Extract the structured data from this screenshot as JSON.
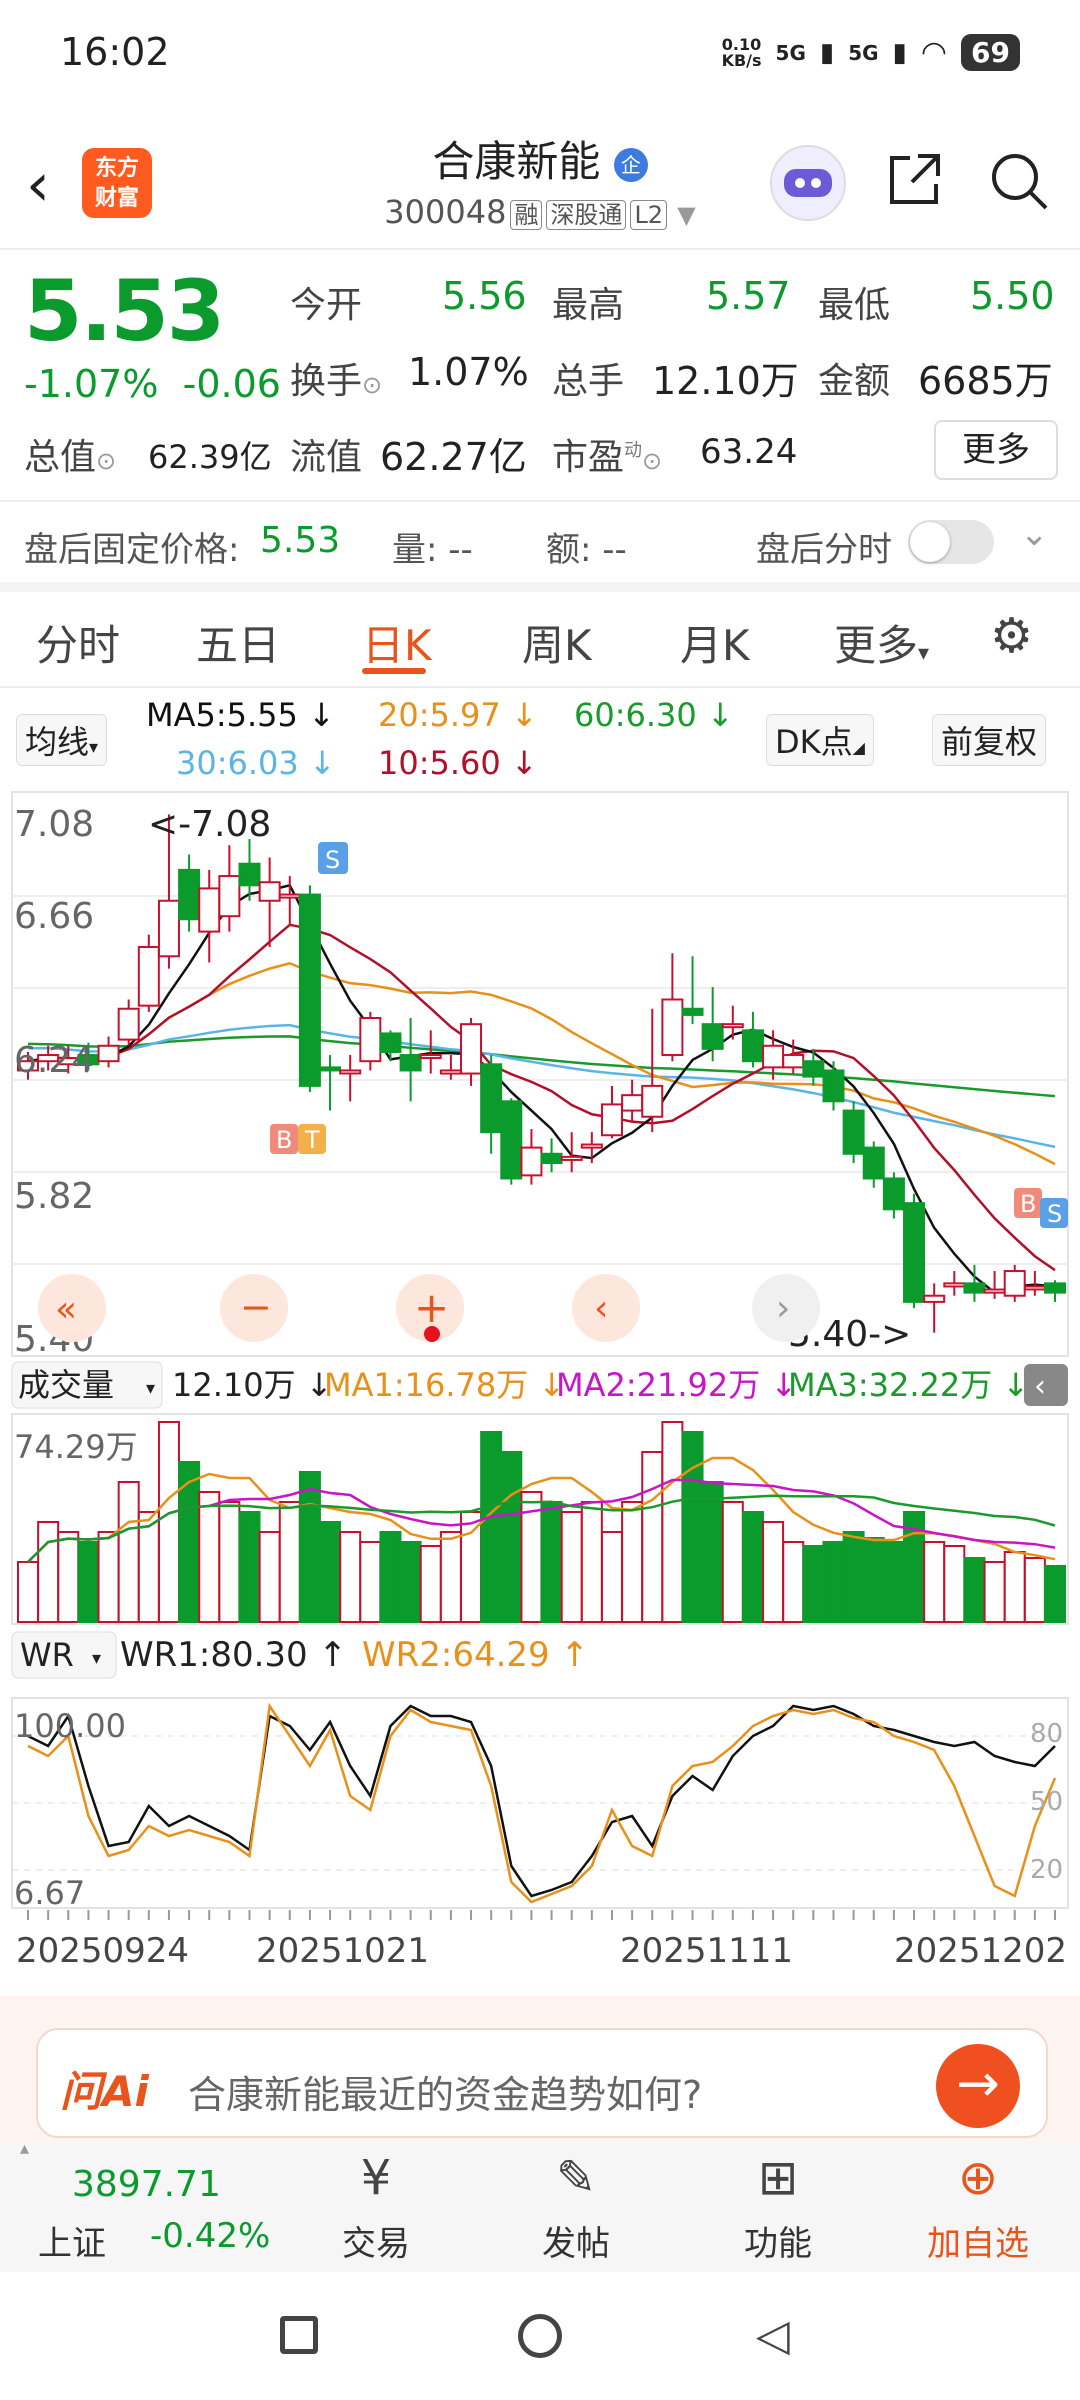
{
  "status": {
    "time": "16:02",
    "net_speed": "0.10\nKB/s",
    "signal1": "5G",
    "signal2": "5G",
    "battery": "69"
  },
  "header": {
    "logo_line1": "东方",
    "logo_line2": "财富",
    "stock_name": "合康新能",
    "badge": "企",
    "code": "300048",
    "tags": [
      "融",
      "深股通",
      "L2"
    ]
  },
  "quote": {
    "price": "5.53",
    "change_pct": "-1.07%",
    "change": "-0.06",
    "open_label": "今开",
    "open": "5.56",
    "high_label": "最高",
    "high": "5.57",
    "low_label": "最低",
    "low": "5.50",
    "turnover_label": "换手",
    "turnover": "1.07%",
    "volume_label": "总手",
    "volume": "12.10万",
    "amount_label": "金额",
    "amount": "6685万",
    "mcap_label": "总值",
    "mcap": "62.39亿",
    "float_label": "流值",
    "float": "62.27亿",
    "pe_label": "市盈",
    "pe_sup": "动",
    "pe": "63.24",
    "more": "更多"
  },
  "after_hours": {
    "label": "盘后固定价格:",
    "price": "5.53",
    "vol_label": "量: --",
    "amt_label": "额: --",
    "toggle_label": "盘后分时"
  },
  "tabs": [
    "分时",
    "五日",
    "日K",
    "周K",
    "月K",
    "更多"
  ],
  "ma_bar": {
    "selector": "均线",
    "ma5": "MA5:5.55 ↓",
    "ma20": "20:5.97 ↓",
    "ma60": "60:6.30 ↓",
    "ma30": "30:6.03 ↓",
    "ma10": "10:5.60 ↓",
    "dk": "DK点",
    "fq": "前复权"
  },
  "kline": {
    "y_labels": [
      "7.08",
      "6.66",
      "6.24",
      "5.82",
      "5.40"
    ],
    "high_marker": "<-7.08",
    "low_marker": "5.40->",
    "signal_buy": "B",
    "signal_t": "T",
    "signal_sell": "S"
  },
  "volume_bar": {
    "selector": "成交量",
    "value": "12.10万 ↓",
    "ma1": "MA1:16.78万 ↓",
    "ma2": "MA2:21.92万 ↓",
    "ma3": "MA3:32.22万 ↓",
    "top_label": "74.29万"
  },
  "wr_bar": {
    "selector": "WR",
    "wr1": "WR1:80.30 ↑",
    "wr2": "WR2:64.29 ↑",
    "top_label": "100.00",
    "bottom_label": "6.67",
    "right_labels": [
      "80",
      "50",
      "20"
    ]
  },
  "dates": [
    "20250924",
    "20251021",
    "20251111",
    "20251202"
  ],
  "ai": {
    "logo": "问Ai",
    "prompt": "合康新能最近的资金趋势如何?"
  },
  "bottom_nav": {
    "index_value": "3897.71",
    "index_name": "上证",
    "index_change": "-0.42%",
    "trade": "交易",
    "post": "发帖",
    "func": "功能",
    "watch": "加自选"
  },
  "colors": {
    "up": "#c8102e",
    "down": "#0a9b2c",
    "accent": "#e8541c",
    "ma5": "#111111",
    "ma10": "#b0102a",
    "ma20": "#e8901a",
    "ma30": "#5ab4e6",
    "ma60": "#1a9a2a"
  }
}
